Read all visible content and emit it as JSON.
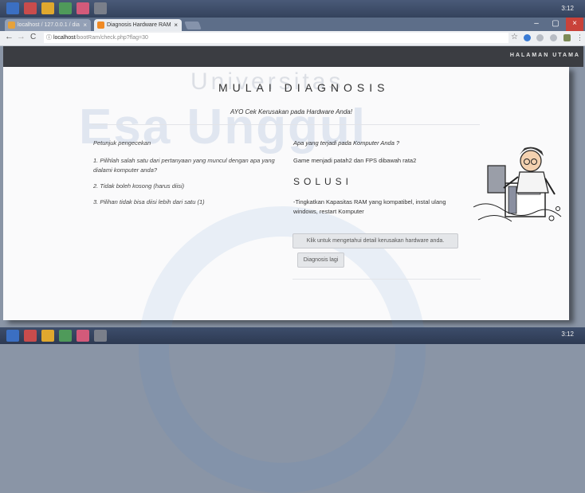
{
  "os": {
    "clock": "3:12",
    "clock_bottom": "3:12"
  },
  "browser": {
    "tabs": [
      {
        "label": "localhost / 127.0.0.1 / dia",
        "active": false
      },
      {
        "label": "Diagnosis Hardware RAM",
        "active": true
      }
    ],
    "close_glyph": "×",
    "window_controls": [
      "–",
      "▢",
      "×"
    ],
    "nav": {
      "back": "←",
      "forward": "→",
      "reload": "C",
      "info": "ⓘ"
    },
    "url_host": "localhost",
    "url_path": "/bootRam/check.php?flag=30",
    "star": "☆"
  },
  "navbar": {
    "link": "HALAMAN UTAMA"
  },
  "watermark": {
    "line1": "Esa Unggul",
    "line2": "Universitas"
  },
  "main": {
    "title": "MULAI DIAGNOSIS",
    "subtitle": "AYO Cek Kerusakan pada Hardware Anda!",
    "instructions": {
      "heading": "Petunjuk pengecekan",
      "items": [
        "1. Pilihlah salah satu dari pertanyaan yang muncul dengan apa yang dialami komputer anda?",
        "2. Tidak boleh kosong (harus diisi)",
        "3. Pilihan tidak bisa diisi lebih dari satu (1)"
      ]
    },
    "result": {
      "question": "Apa yang terjadi pada Komputer Anda ?",
      "answer": "Game menjadi patah2 dan FPS dibawah rata2",
      "solution_heading": "SOLUSI",
      "solution_text": "-Tingkatkan Kapasitas RAM yang kompatibel, instal ulang windows, restart Komputer",
      "detail_button": "Klik untuk mengetahui detail kerusakan hardware anda.",
      "retry_button": "Diagnosis lagi"
    }
  },
  "colors": {
    "navbar": "#3b3d42",
    "page": "#fafafb",
    "taskbar": "#34425c"
  }
}
